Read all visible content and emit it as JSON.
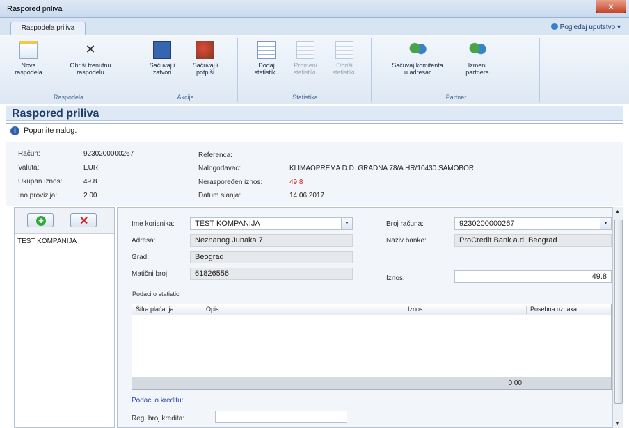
{
  "window": {
    "title": "Raspored priliva",
    "close": "x"
  },
  "tabs": {
    "active": "Raspodela priliva",
    "help": "Pogledaj uputstvo"
  },
  "ribbon": {
    "groups": [
      "Raspodela",
      "Akcije",
      "Statistika",
      "Partner"
    ],
    "buttons": {
      "nova": "Nova raspodela",
      "obrisi_line1": "Obriši trenutnu",
      "obrisi_line2": "raspodelu",
      "sacuvaj_zatvori_1": "Sačuvaj i",
      "sacuvaj_zatvori_2": "zatvori",
      "sacuvaj_potpisi_1": "Sačuvaj i",
      "sacuvaj_potpisi_2": "potpiši",
      "dodaj_1": "Dodaj",
      "dodaj_2": "statistiku",
      "promeni_1": "Promeni",
      "promeni_2": "statistiku",
      "obrisi_stat_1": "Obriši",
      "obrisi_stat_2": "statistiku",
      "komitent_1": "Sačuvaj komitenta",
      "komitent_2": "u adresar",
      "izmeni_1": "Izmeni",
      "izmeni_2": "partnera"
    }
  },
  "page_title": "Raspored priliva",
  "info_message": "Popunite nalog.",
  "summary": {
    "racun_label": "Račun:",
    "racun": "9230200000267",
    "valuta_label": "Valuta:",
    "valuta": "EUR",
    "ukupan_label": "Ukupan iznos:",
    "ukupan": "49.8",
    "provizija_label": "Ino provizija:",
    "provizija": "2.00",
    "referenca_label": "Referenca:",
    "referenca": "",
    "nalogodavac_label": "Nalogodavac:",
    "nalogodavac": "KLIMAOPREMA D.D. GRADNA 78/A HR/10430 SAMOBOR",
    "neraspor_label": "Neraspoređen iznos:",
    "neraspor": "49.8",
    "datum_label": "Datum slanja:",
    "datum": "14.06.2017"
  },
  "left_list": {
    "items": [
      "TEST KOMPANIJA"
    ],
    "add_icon": "plus-icon",
    "delete_icon": "x-icon"
  },
  "form": {
    "ime_label": "Ime korisnika:",
    "ime": "TEST KOMPANIJA",
    "adresa_label": "Adresa:",
    "adresa": "Neznanog Junaka 7",
    "grad_label": "Grad:",
    "grad": "Beograd",
    "mb_label": "Matični broj:",
    "mb": "61826556",
    "broj_label": "Broj računa:",
    "broj": "9230200000267",
    "banka_label": "Naziv banke:",
    "banka": "ProCredit Bank a.d. Beograd",
    "iznos_label": "Iznos:",
    "iznos": "49.8",
    "stat_legend": "Podaci o statistici",
    "columns": [
      "Šifra plaćanja",
      "Opis",
      "Iznos",
      "Posebna oznaka"
    ],
    "total": "0.00",
    "kredit_header": "Podaci o kreditu:",
    "reg_label": "Reg. broj kredita:",
    "reg": ""
  }
}
